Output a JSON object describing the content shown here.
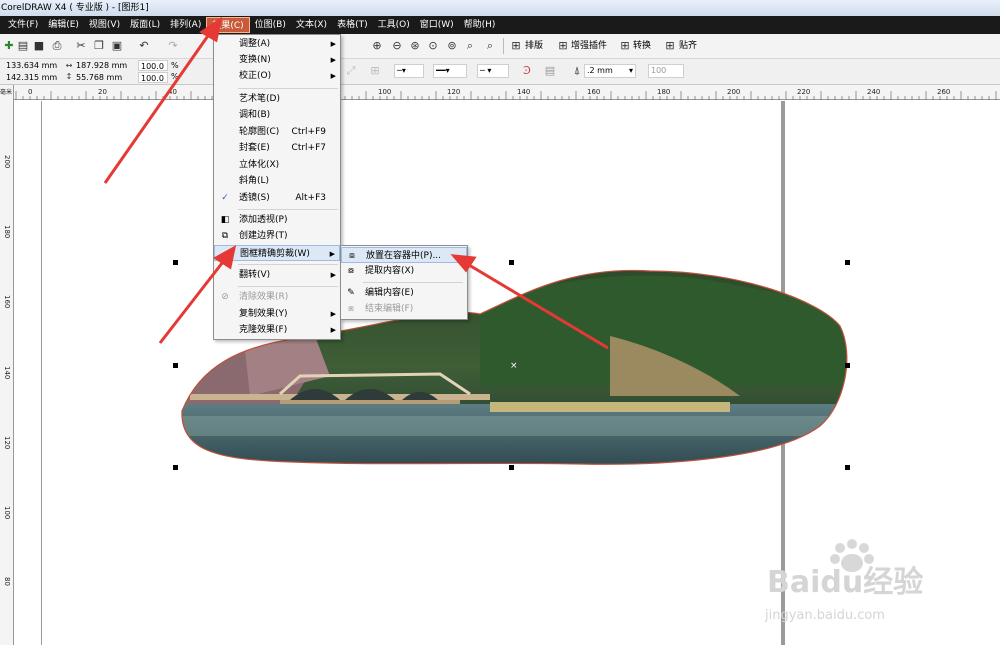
{
  "window": {
    "title": "CorelDRAW X4 ( 专业版 ) - [图形1]"
  },
  "menubar": {
    "items": [
      "文件(F)",
      "编辑(E)",
      "视图(V)",
      "版面(L)",
      "排列(A)",
      "效果(C)",
      "位图(B)",
      "文本(X)",
      "表格(T)",
      "工具(O)",
      "窗口(W)",
      "帮助(H)"
    ],
    "active": "效果(C)"
  },
  "toolbar": {
    "buttons": [
      "排版",
      "增强插件",
      "转换",
      "贴齐"
    ]
  },
  "properties": {
    "x": "133.634 mm",
    "y": "142.315 mm",
    "width": "187.928 mm",
    "height": "55.768 mm",
    "scale_x": "100.0",
    "scale_y": "100.0",
    "pct": "%",
    "outline_width": ".2 mm",
    "opacity": "100"
  },
  "ruler": {
    "h_labels": [
      "0",
      "20",
      "40",
      "100",
      "120",
      "140",
      "160",
      "180",
      "200",
      "220",
      "240",
      "260"
    ],
    "v_labels": [
      "200",
      "180",
      "160",
      "140",
      "120",
      "100",
      "80"
    ],
    "corner": "毫米"
  },
  "effects_menu": {
    "items": [
      {
        "label": "调整(A)",
        "submenu": true
      },
      {
        "label": "变换(N)",
        "submenu": true
      },
      {
        "label": "校正(O)",
        "submenu": true
      },
      {
        "label": "艺术笔(D)"
      },
      {
        "label": "调和(B)"
      },
      {
        "label": "轮廓图(C)",
        "shortcut": "Ctrl+F9"
      },
      {
        "label": "封套(E)",
        "shortcut": "Ctrl+F7"
      },
      {
        "label": "立体化(X)"
      },
      {
        "label": "斜角(L)"
      },
      {
        "label": "透镜(S)",
        "shortcut": "Alt+F3",
        "checked": true
      },
      {
        "label": "添加透视(P)"
      },
      {
        "label": "创建边界(T)"
      },
      {
        "label": "图框精确剪裁(W)",
        "submenu": true,
        "highlighted": true
      },
      {
        "label": "翻转(V)",
        "submenu": true
      },
      {
        "label": "清除效果(R)",
        "disabled": true
      },
      {
        "label": "复制效果(Y)",
        "submenu": true
      },
      {
        "label": "克隆效果(F)",
        "submenu": true
      }
    ]
  },
  "powerclip_submenu": {
    "items": [
      {
        "label": "放置在容器中(P)...",
        "highlighted": true
      },
      {
        "label": "提取内容(X)"
      },
      {
        "label": "编辑内容(E)"
      },
      {
        "label": "结束编辑(F)",
        "disabled": true
      }
    ]
  },
  "watermark": {
    "brand": "Baidu经验",
    "url": "jingyan.baidu.com"
  },
  "colors": {
    "menubar_bg": "#1a1a1a",
    "menu_active": "#c95b3b",
    "arrow": "#e53935",
    "highlight": "#dde8f7"
  }
}
